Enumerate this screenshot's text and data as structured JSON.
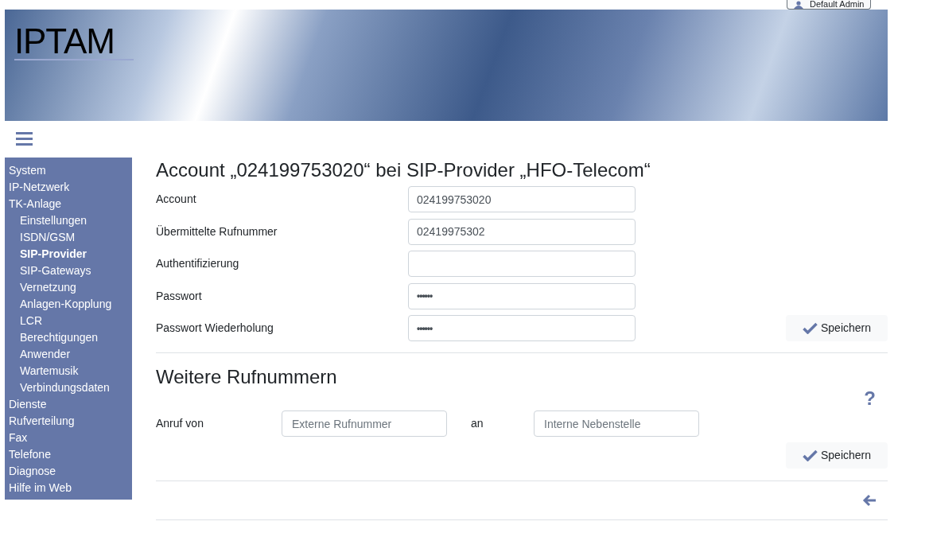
{
  "user_button": {
    "label": "Default Admin"
  },
  "logo": {
    "text": "IPTAM"
  },
  "sidebar": {
    "items": [
      {
        "label": "System",
        "selected": false
      },
      {
        "label": "IP-Netzwerk",
        "selected": false
      },
      {
        "label": "TK-Anlage",
        "selected": false,
        "children": [
          {
            "label": "Einstellungen",
            "selected": false
          },
          {
            "label": "ISDN/GSM",
            "selected": false
          },
          {
            "label": "SIP-Provider",
            "selected": true
          },
          {
            "label": "SIP-Gateways",
            "selected": false
          },
          {
            "label": "Vernetzung",
            "selected": false
          },
          {
            "label": "Anlagen-Kopplung",
            "selected": false
          },
          {
            "label": "LCR",
            "selected": false
          },
          {
            "label": "Berechtigungen",
            "selected": false
          },
          {
            "label": "Anwender",
            "selected": false
          },
          {
            "label": "Wartemusik",
            "selected": false
          },
          {
            "label": "Verbindungsdaten",
            "selected": false
          }
        ]
      },
      {
        "label": "Dienste",
        "selected": false
      },
      {
        "label": "Rufverteilung",
        "selected": false
      },
      {
        "label": "Fax",
        "selected": false
      },
      {
        "label": "Telefone",
        "selected": false
      },
      {
        "label": "Diagnose",
        "selected": false
      },
      {
        "label": "Hilfe im Web",
        "selected": false
      }
    ]
  },
  "account_form": {
    "title": "Account „024199753020“ bei SIP-Provider „HFO-Telecom“",
    "fields": [
      {
        "label": "Account",
        "value": "024199753020",
        "kind": "text"
      },
      {
        "label": "Übermittelte Rufnummer",
        "value": "02419975302",
        "kind": "text"
      },
      {
        "label": "Authentifizierung",
        "kind": "text"
      },
      {
        "label": "Passwort",
        "value": "••••••",
        "kind": "password"
      },
      {
        "label": "Passwort Wiederholung",
        "value": "••••••",
        "kind": "password"
      }
    ],
    "save_button": "Speichern"
  },
  "numbers_section": {
    "title": "Weitere Rufnummern",
    "help": "?",
    "row": {
      "label": "Anruf von",
      "from_placeholder": "Externe Rufnummer",
      "connector": "an",
      "to_placeholder": "Interne Nebenstelle"
    },
    "save_button": "Speichern"
  }
}
